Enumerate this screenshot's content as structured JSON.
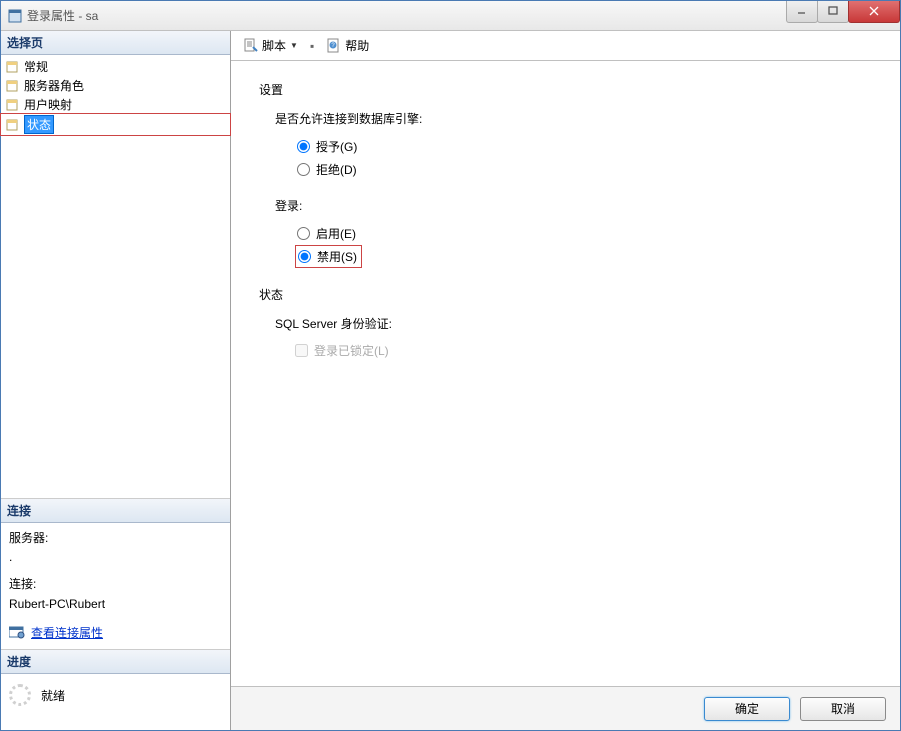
{
  "window": {
    "title": "登录属性 - sa"
  },
  "leftPanel": {
    "selectPageHeader": "选择页",
    "navItems": [
      {
        "label": "常规"
      },
      {
        "label": "服务器角色"
      },
      {
        "label": "用户映射"
      },
      {
        "label": "状态"
      }
    ],
    "connection": {
      "header": "连接",
      "serverLabel": "服务器:",
      "serverValue": ".",
      "connLabel": "连接:",
      "connValue": "Rubert-PC\\Rubert",
      "viewConnPropsLink": "查看连接属性"
    },
    "progress": {
      "header": "进度",
      "statusText": "就绪"
    }
  },
  "toolbar": {
    "scriptLabel": "脚本",
    "helpLabel": "帮助"
  },
  "content": {
    "settingsHeader": "设置",
    "permissionQuestion": "是否允许连接到数据库引擎:",
    "grantLabel": "授予(G)",
    "denyLabel": "拒绝(D)",
    "loginHeader": "登录:",
    "enableLabel": "启用(E)",
    "disableLabel": "禁用(S)",
    "statusHeader": "状态",
    "sqlAuthLabel": "SQL Server 身份验证:",
    "lockedLabel": "登录已锁定(L)"
  },
  "footer": {
    "okLabel": "确定",
    "cancelLabel": "取消"
  }
}
